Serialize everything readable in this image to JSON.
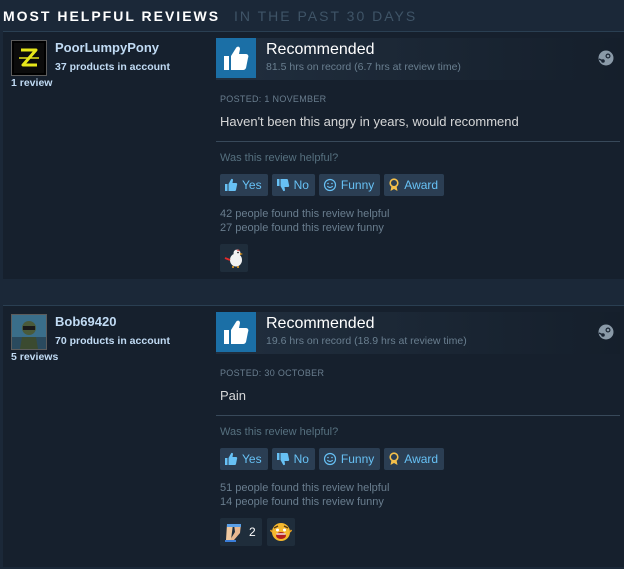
{
  "header": {
    "title": "MOST HELPFUL REVIEWS",
    "subtitle": "IN THE PAST 30 DAYS"
  },
  "colors": {
    "accent": "#67c1f5",
    "thumb_bg": "#1b6fa6",
    "page_bg": "#1b2838"
  },
  "reviews": [
    {
      "author": {
        "name": "PoorLumpyPony",
        "products": "37 products in account",
        "reviews": "1 review",
        "avatar_icon": "yellow-z-logo-icon"
      },
      "verdict": "Recommended",
      "hours": "81.5 hrs on record (6.7 hrs at review time)",
      "posted": "POSTED: 1 NOVEMBER",
      "text": "Haven't been this angry in years, would recommend",
      "helpful_question": "Was this review helpful?",
      "buttons": {
        "yes": "Yes",
        "no": "No",
        "funny": "Funny",
        "award": "Award"
      },
      "found_helpful": "42 people found this review helpful",
      "found_funny": "27 people found this review funny",
      "awards": [
        {
          "icon": "chicken-award-icon",
          "count": ""
        }
      ]
    },
    {
      "author": {
        "name": "Bob69420",
        "products": "70 products in account",
        "reviews": "5 reviews",
        "avatar_icon": "character-avatar-icon"
      },
      "verdict": "Recommended",
      "hours": "19.6 hrs on record (18.9 hrs at review time)",
      "posted": "POSTED: 30 OCTOBER",
      "text": "Pain",
      "helpful_question": "Was this review helpful?",
      "buttons": {
        "yes": "Yes",
        "no": "No",
        "funny": "Funny",
        "award": "Award"
      },
      "found_helpful": "51 people found this review helpful",
      "found_funny": "14 people found this review funny",
      "awards": [
        {
          "icon": "legs-award-icon",
          "count": "2"
        },
        {
          "icon": "screaming-face-award-icon",
          "count": ""
        }
      ]
    }
  ]
}
